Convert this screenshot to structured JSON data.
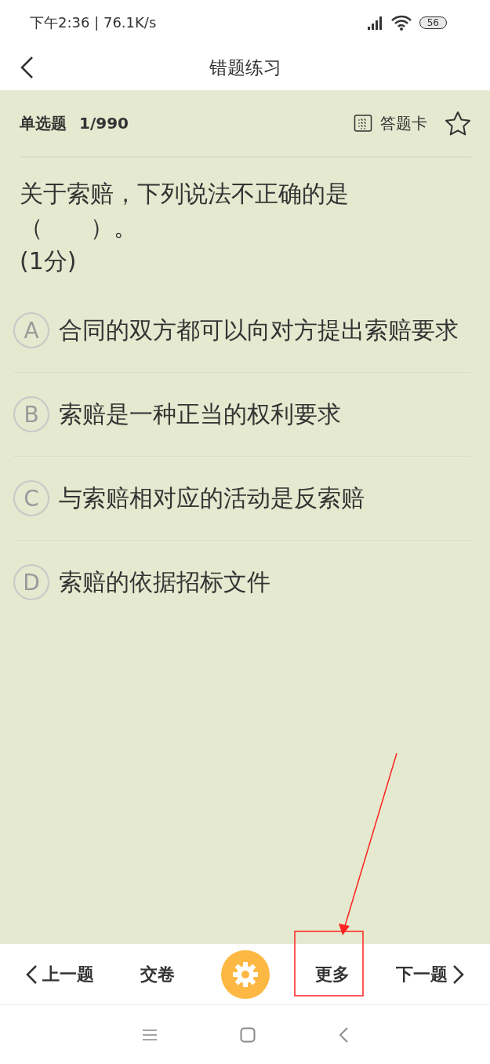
{
  "status_bar": {
    "time": "下午2:36 | 76.1K/s",
    "battery": "56"
  },
  "header": {
    "title": "错题练习"
  },
  "question_bar": {
    "type": "单选题",
    "progress": "1/990",
    "answer_card": "答题卡"
  },
  "question": {
    "lines": [
      "关于索赔，下列说法不正确的是",
      "（　　）。",
      "(1分)"
    ]
  },
  "options": [
    {
      "letter": "A",
      "text": "合同的双方都可以向对方提出索赔要求"
    },
    {
      "letter": "B",
      "text": "索赔是一种正当的权利要求"
    },
    {
      "letter": "C",
      "text": "与索赔相对应的活动是反索赔"
    },
    {
      "letter": "D",
      "text": "索赔的依据招标文件"
    }
  ],
  "bottom_bar": {
    "prev": "上一题",
    "submit": "交卷",
    "more": "更多",
    "next": "下一题"
  },
  "annotation": {
    "shown": true
  }
}
